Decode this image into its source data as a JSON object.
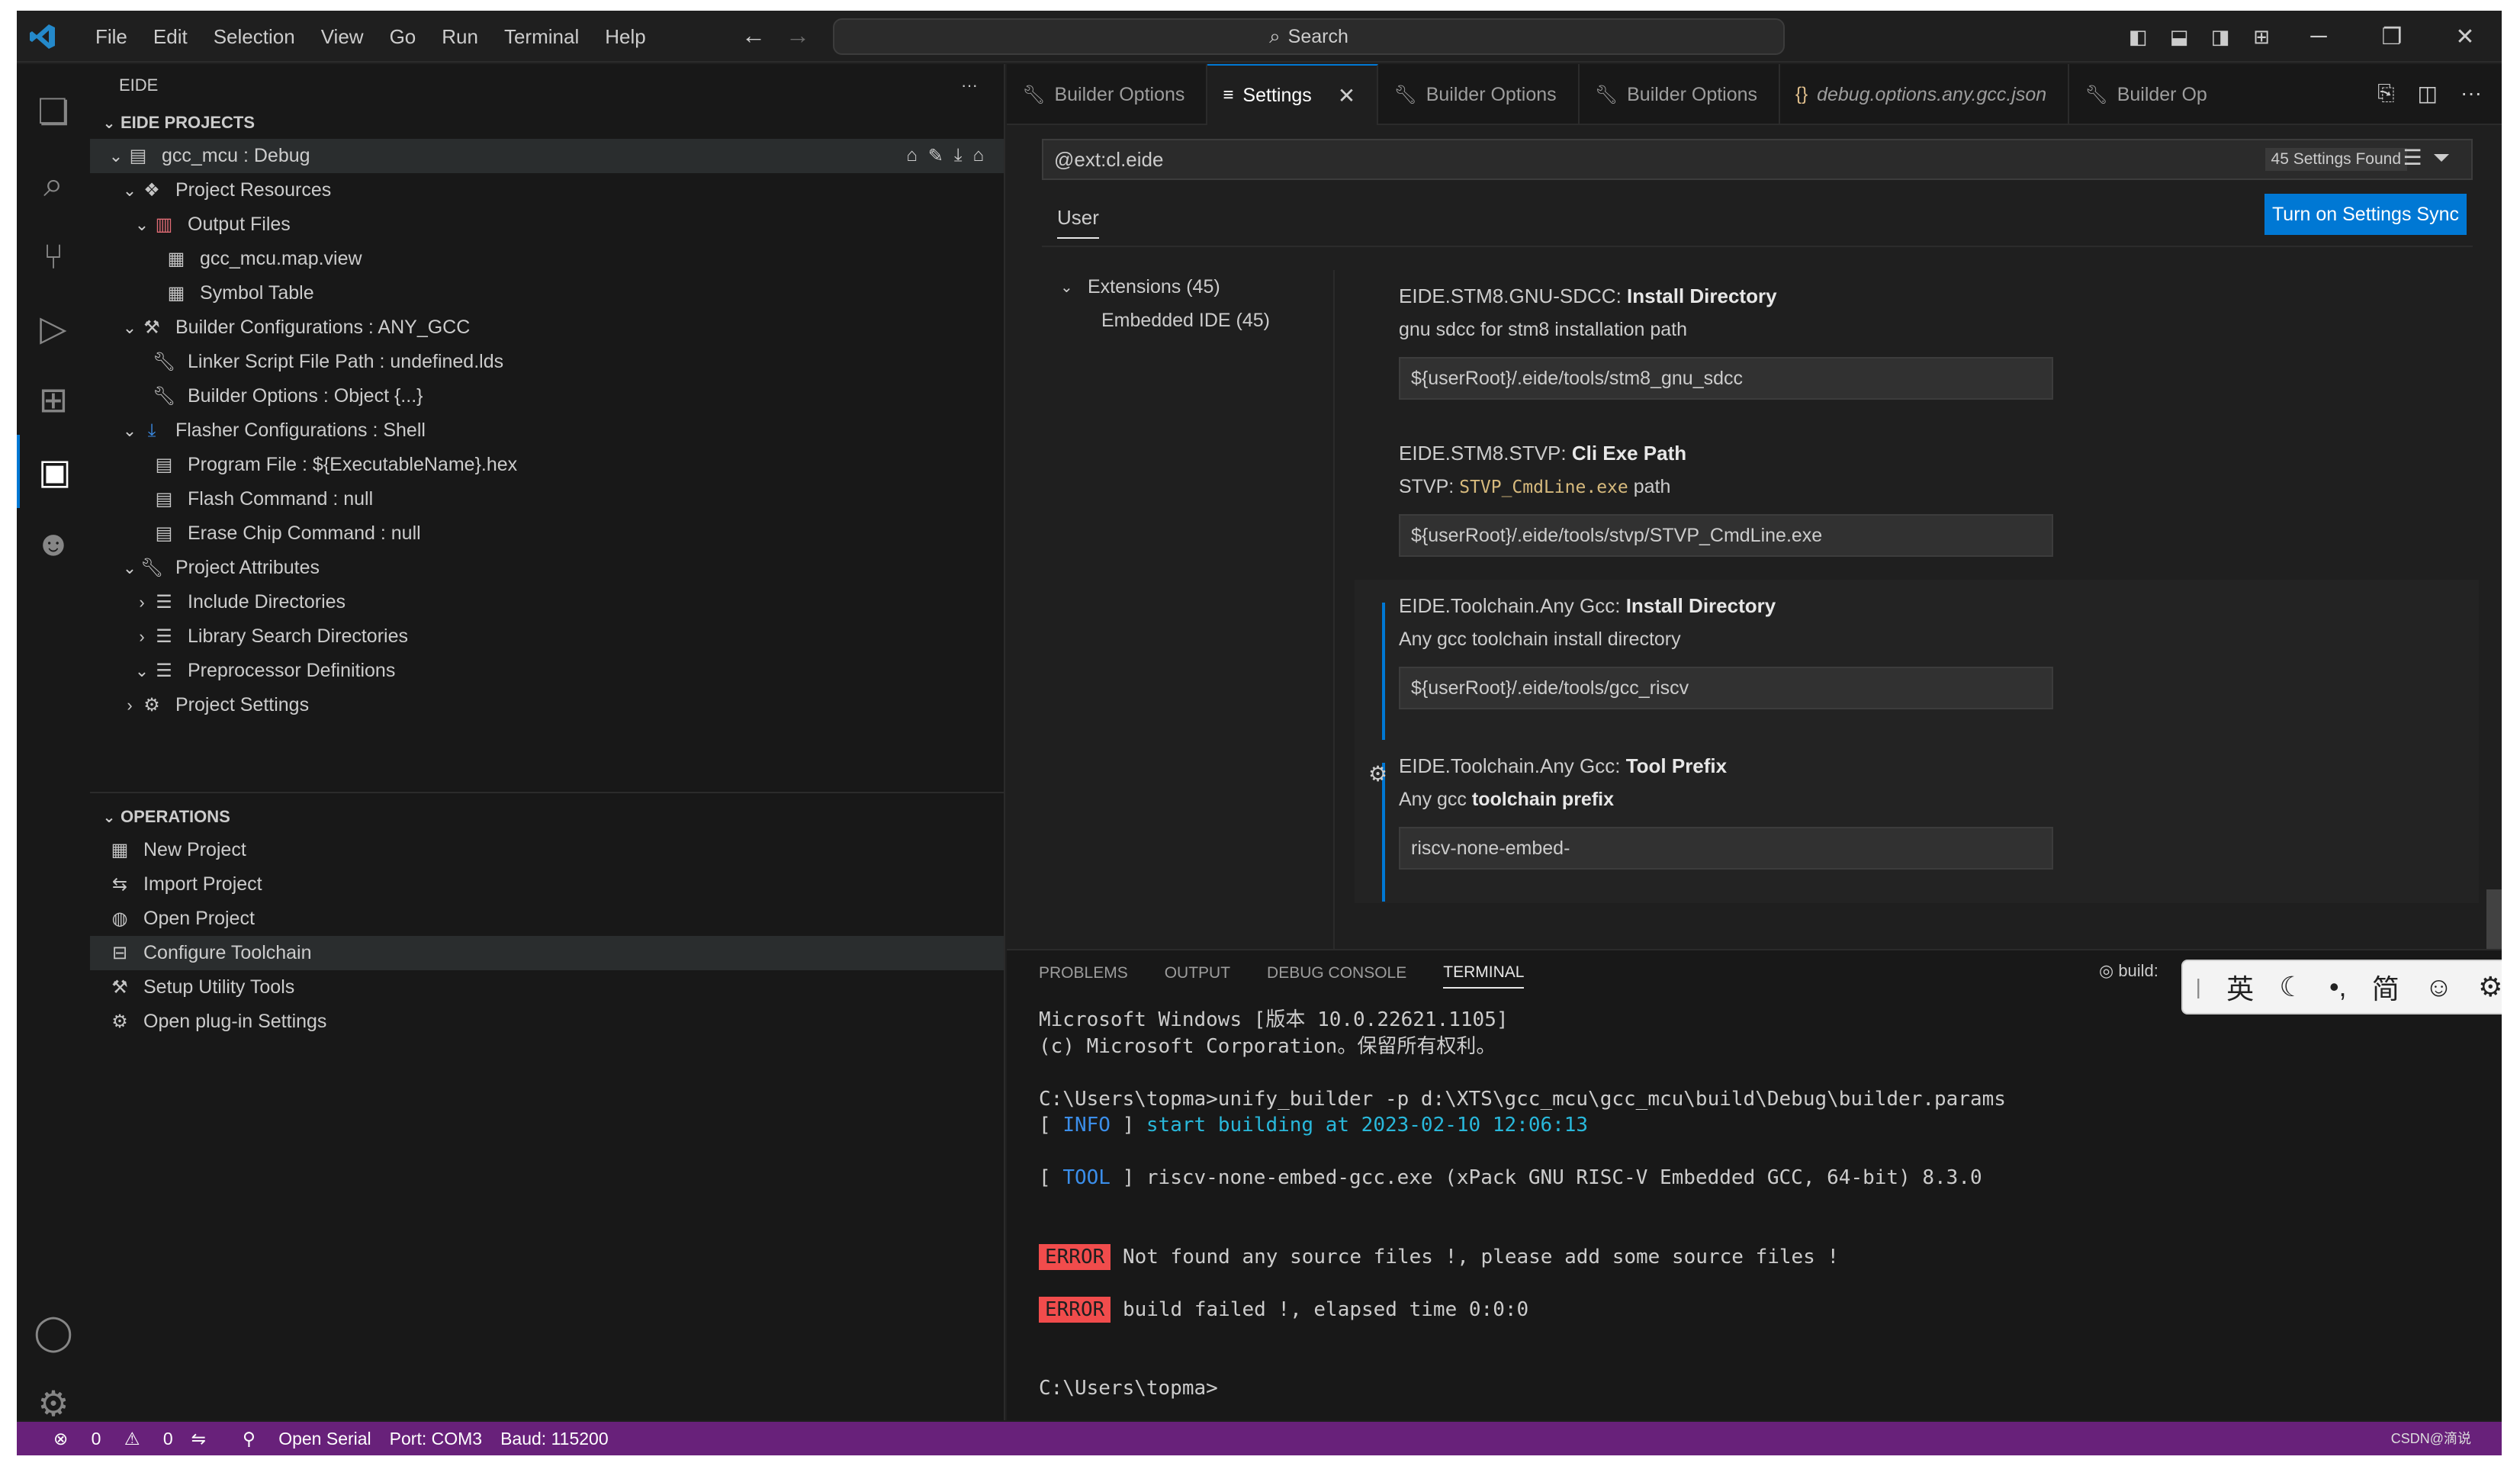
{
  "menu": [
    "File",
    "Edit",
    "Selection",
    "View",
    "Go",
    "Run",
    "Terminal",
    "Help"
  ],
  "search": {
    "label": "Search"
  },
  "sidebar": {
    "title": "EIDE",
    "projects_header": "EIDE PROJECTS",
    "tree": [
      {
        "label": "gcc_mcu : Debug",
        "icon": "project-icon"
      },
      {
        "label": "Project Resources",
        "icon": "resources-icon"
      },
      {
        "label": "Output Files",
        "icon": "output-folder-icon"
      },
      {
        "label": "gcc_mcu.map.view",
        "icon": "map-file-icon"
      },
      {
        "label": "Symbol Table",
        "icon": "table-icon"
      },
      {
        "label": "Builder Configurations : ANY_GCC",
        "icon": "builder-icon"
      },
      {
        "label": "Linker Script File Path : undefined.lds",
        "icon": "wrench-icon"
      },
      {
        "label": "Builder Options : Object {...}",
        "icon": "wrench-icon"
      },
      {
        "label": "Flasher Configurations : Shell",
        "icon": "download-icon"
      },
      {
        "label": "Program File : ${ExecutableName}.hex",
        "icon": "file-icon"
      },
      {
        "label": "Flash Command : null",
        "icon": "file-icon"
      },
      {
        "label": "Erase Chip Command : null",
        "icon": "file-icon"
      },
      {
        "label": "Project Attributes",
        "icon": "wrench-icon"
      },
      {
        "label": "Include Directories",
        "icon": "list-icon"
      },
      {
        "label": "Library Search Directories",
        "icon": "list-icon"
      },
      {
        "label": "Preprocessor Definitions",
        "icon": "list-icon"
      },
      {
        "label": "Project Settings",
        "icon": "gear-icon"
      }
    ],
    "operations_header": "OPERATIONS",
    "operations": [
      {
        "label": "New Project"
      },
      {
        "label": "Import Project"
      },
      {
        "label": "Open Project"
      },
      {
        "label": "Configure Toolchain"
      },
      {
        "label": "Setup Utility Tools"
      },
      {
        "label": "Open plug-in Settings"
      }
    ]
  },
  "tabs": [
    {
      "label": "Builder Options"
    },
    {
      "label": "Settings"
    },
    {
      "label": "Builder Options"
    },
    {
      "label": "Builder Options"
    },
    {
      "label": "debug.options.any.gcc.json"
    },
    {
      "label": "Builder Op"
    }
  ],
  "settings": {
    "query": "@ext:cl.eide",
    "found": "45 Settings Found",
    "scope_tab": "User",
    "sync_button": "Turn on Settings Sync",
    "toc": [
      {
        "label": "Extensions (45)"
      },
      {
        "label": "Embedded IDE (45)"
      }
    ],
    "items": [
      {
        "prefix": "EIDE.STM8.GNU-SDCC: ",
        "name": "Install Directory",
        "desc": "gnu sdcc for stm8 installation path",
        "value": "${userRoot}/.eide/tools/stm8_gnu_sdcc"
      },
      {
        "prefix": "EIDE.STM8.STVP: ",
        "name": "Cli Exe Path",
        "desc_pre": "STVP: ",
        "desc_code": "STVP_CmdLine.exe",
        "desc_post": " path",
        "value": "${userRoot}/.eide/tools/stvp/STVP_CmdLine.exe"
      },
      {
        "prefix": "EIDE.Toolchain.Any Gcc: ",
        "name": "Install Directory",
        "desc": "Any gcc toolchain install directory",
        "value": "${userRoot}/.eide/tools/gcc_riscv"
      },
      {
        "prefix": "EIDE.Toolchain.Any Gcc: ",
        "name": "Tool Prefix",
        "desc_pre": "Any gcc ",
        "desc_bold": "toolchain prefix",
        "value": "riscv-none-embed-"
      }
    ]
  },
  "panel": {
    "tabs": [
      "PROBLEMS",
      "OUTPUT",
      "DEBUG CONSOLE",
      "TERMINAL"
    ],
    "task": "build:",
    "ime": [
      "英",
      "简"
    ],
    "terminal": {
      "l1": "Microsoft Windows [版本 10.0.22621.1105]",
      "l2": "(c) Microsoft Corporation。保留所有权利。",
      "l3": "C:\\Users\\topma>unify_builder -p d:\\XTS\\gcc_mcu\\gcc_mcu\\build\\Debug\\builder.params",
      "info_tag": "INFO",
      "info_msg": "start building at 2023-02-10 12:06:13",
      "tool_tag": "TOOL",
      "tool_msg": "riscv-none-embed-gcc.exe (xPack GNU RISC-V Embedded GCC, 64-bit) 8.3.0",
      "err_tag": "ERROR",
      "err1": "Not found any source files !, please add some source files !",
      "err2": "build failed !, elapsed time 0:0:0",
      "prompt": "C:\\Users\\topma>"
    }
  },
  "status": {
    "errors": "0",
    "warnings": "0",
    "serial": "Open Serial",
    "port": "Port: COM3",
    "baud": "Baud: 115200",
    "watermark": "CSDN@滴说"
  },
  "colors": {
    "accent": "#0078d4",
    "statusbar": "#68217a",
    "error": "#f14c4c"
  }
}
